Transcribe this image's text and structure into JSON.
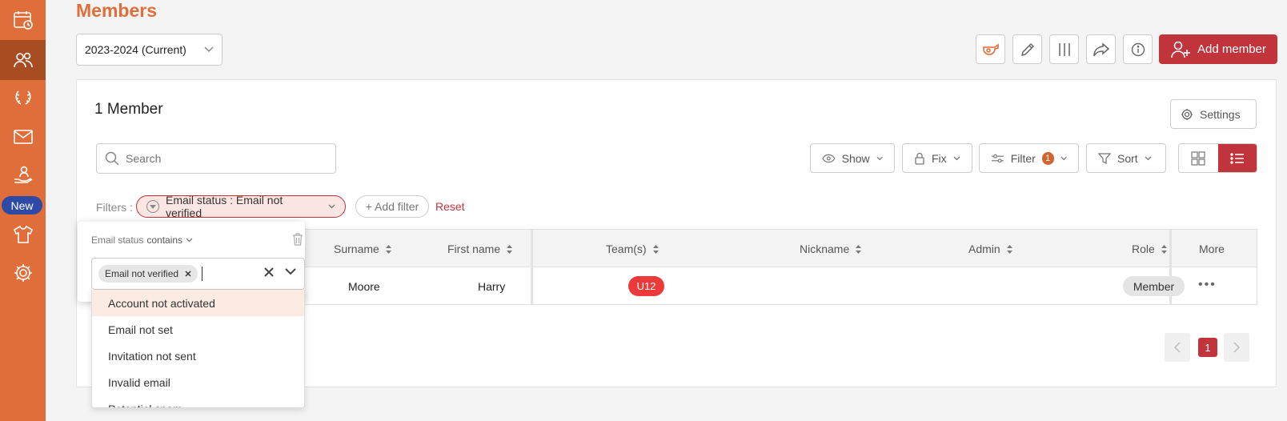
{
  "colors": {
    "brand": "#e06e3a",
    "accent": "#c1343b",
    "sidebar_active": "#a84d22",
    "new_badge": "#2f4aa6",
    "team_badge": "#ec3a3a"
  },
  "sidebar": {
    "items": [
      {
        "icon": "calendar-clock-icon"
      },
      {
        "icon": "members-icon",
        "active": true
      },
      {
        "icon": "laurel-icon"
      },
      {
        "icon": "mail-icon"
      },
      {
        "icon": "hand-person-icon"
      },
      {
        "icon": "shirt-icon"
      },
      {
        "icon": "gear-icon"
      }
    ],
    "new_badge": "New"
  },
  "header": {
    "title": "Members",
    "season": "2023-2024 (Current)",
    "add_member_label": "Add member"
  },
  "card": {
    "count_title": "1 Member",
    "settings_label": "Settings",
    "search_placeholder": "Search",
    "show_label": "Show",
    "fix_label": "Fix",
    "filter_label": "Filter",
    "filter_count": "1",
    "sort_label": "Sort"
  },
  "filters": {
    "label": "Filters :",
    "chip": "Email status : Email not verified",
    "add_filter": "+ Add filter",
    "reset": "Reset"
  },
  "table": {
    "columns": [
      "Surname",
      "First name",
      "Team(s)",
      "Nickname",
      "Admin",
      "Role",
      "More"
    ],
    "rows": [
      {
        "surname": "Moore",
        "first_name": "Harry",
        "team": "U12",
        "nickname": "",
        "admin": "",
        "role": "Member",
        "more": "•••"
      }
    ]
  },
  "pagination": {
    "current": "1"
  },
  "popover": {
    "field": "Email status",
    "operator": "contains",
    "selected_tag": "Email not verified",
    "options": [
      "Account not activated",
      "Email not set",
      "Invitation not sent",
      "Invalid email",
      "Potential spam"
    ]
  }
}
